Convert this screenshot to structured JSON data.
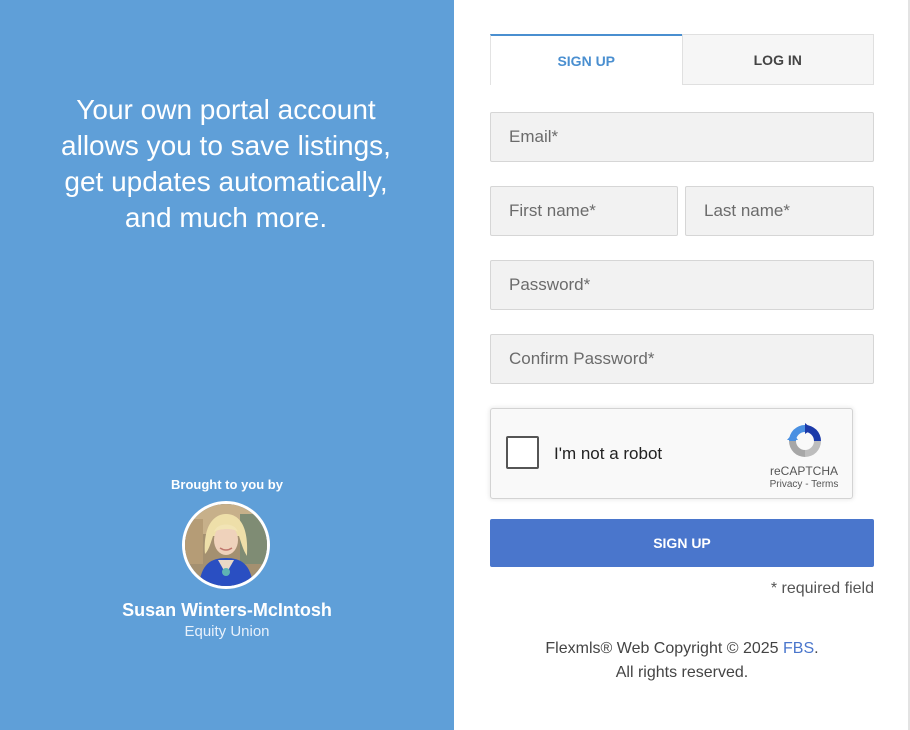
{
  "left": {
    "tagline": "Your own portal account allows you to save listings, get updates automatically, and much more.",
    "brought_by": "Brought to you by",
    "agent_name": "Susan Winters-McIntosh",
    "agent_company": "Equity Union"
  },
  "tabs": {
    "signup": "SIGN UP",
    "login": "LOG IN"
  },
  "form": {
    "email_placeholder": "Email*",
    "first_name_placeholder": "First name*",
    "last_name_placeholder": "Last name*",
    "password_placeholder": "Password*",
    "confirm_password_placeholder": "Confirm Password*",
    "captcha_label": "I'm not a robot",
    "captcha_brand": "reCAPTCHA",
    "captcha_privacy": "Privacy",
    "captcha_separator": " - ",
    "captcha_terms": "Terms",
    "submit_label": "SIGN UP",
    "required_note": "* required field"
  },
  "footer": {
    "copyright_prefix": "Flexmls® Web Copyright © 2025 ",
    "company_link": "FBS",
    "period": ".",
    "rights": "All rights reserved."
  },
  "colors": {
    "left_panel": "#5f9fd8",
    "accent": "#4a8fd0",
    "button": "#4a76cc"
  }
}
